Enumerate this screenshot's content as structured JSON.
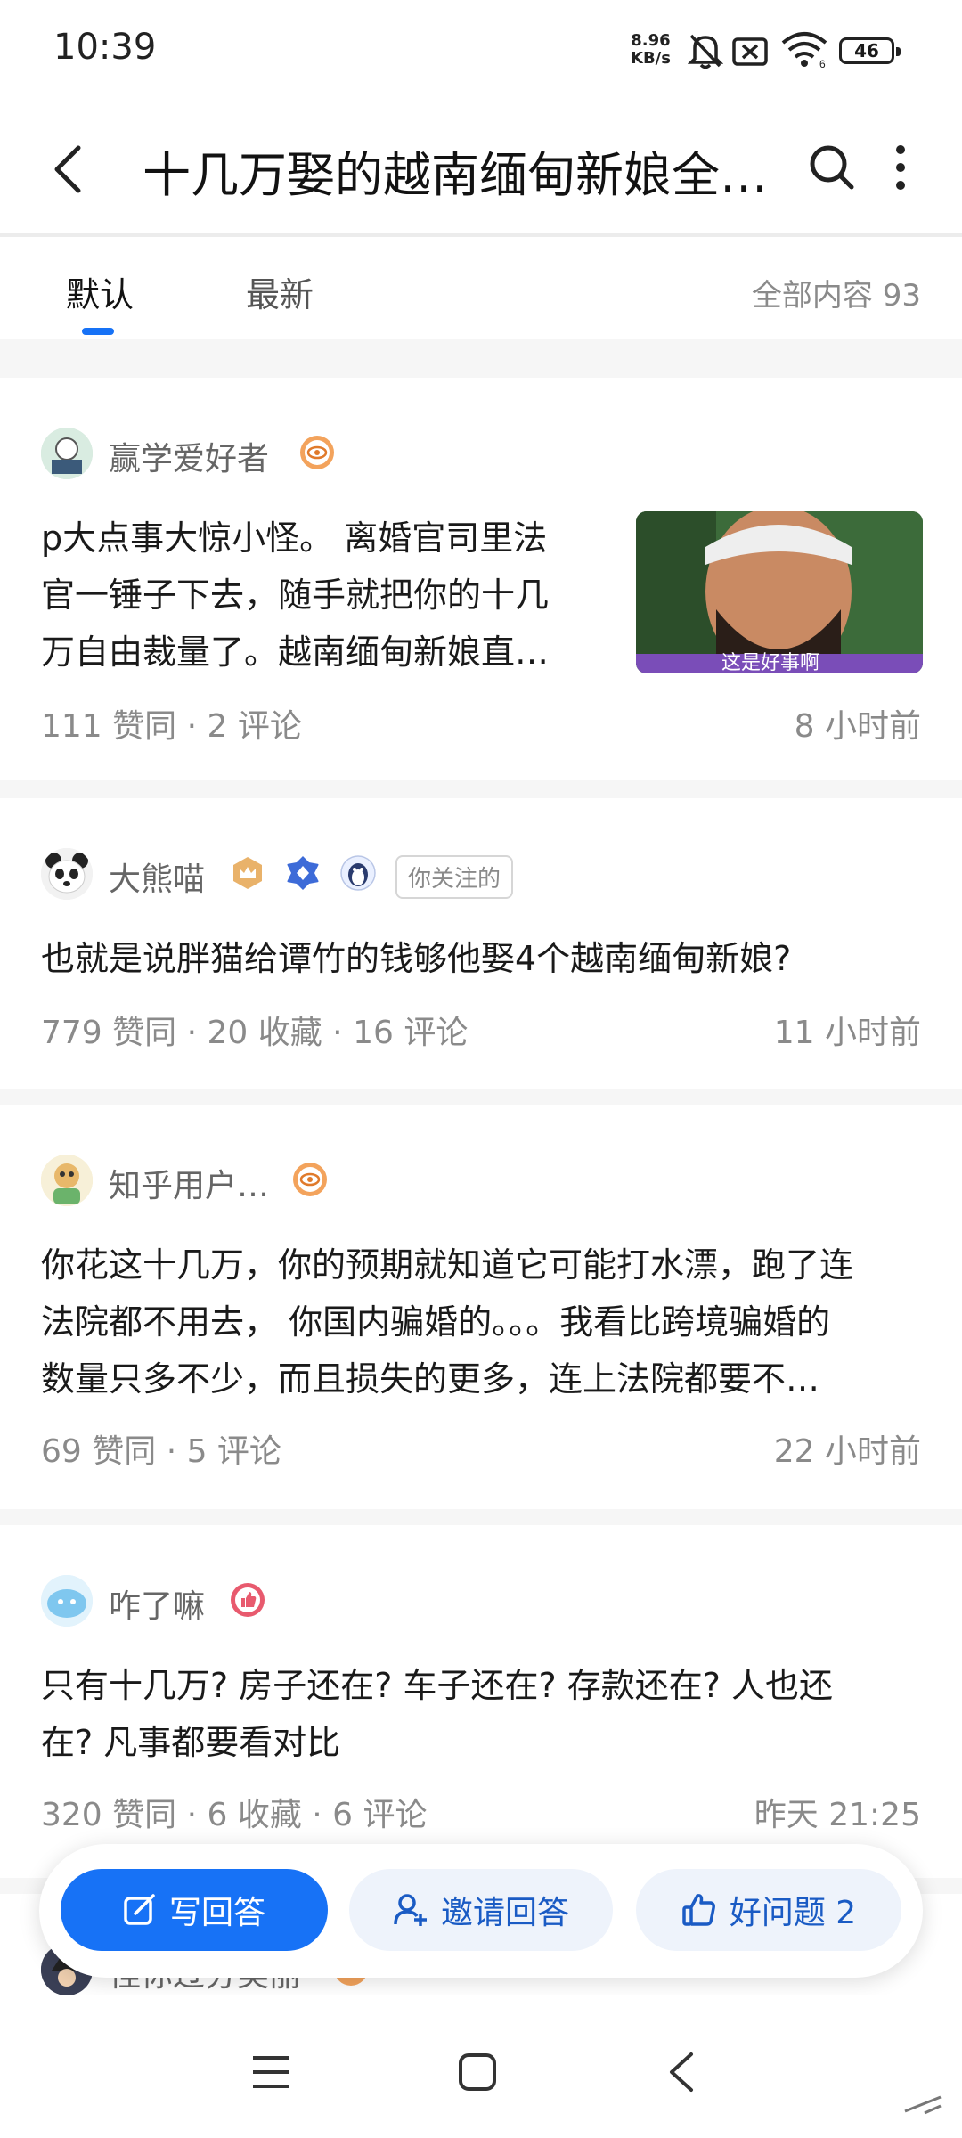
{
  "status_bar": {
    "time": "10:39",
    "net_speed_value": "8.96",
    "net_speed_unit": "KB/s",
    "battery": "46",
    "icons": [
      "bell-off-icon",
      "sim-off-icon",
      "wifi-icon",
      "battery-icon"
    ]
  },
  "header": {
    "title": "十几万娶的越南缅甸新娘全…"
  },
  "tabs": {
    "items": [
      {
        "label": "默认",
        "selected": true
      },
      {
        "label": "最新",
        "selected": false
      }
    ],
    "total": "全部内容 93",
    "accent": "#1772f6"
  },
  "answers": [
    {
      "author": "赢学爱好者",
      "text": [
        "p大点事大惊小怪。 离婚官司里法",
        "官一锤子下去，随手就把你的十几",
        "万自由裁量了。越南缅甸新娘直…"
      ],
      "thumbnail_caption": "这是好事啊",
      "meta": "111 赞同 · 2 评论",
      "time": "8 小时前"
    },
    {
      "author": "大熊喵",
      "follow_tag": "你关注的",
      "text": [
        "也就是说胖猫给谭竹的钱够他娶4个越南缅甸新娘?"
      ],
      "meta": "779 赞同 · 20 收藏 · 16 评论",
      "time": "11 小时前"
    },
    {
      "author": "知乎用户…",
      "text": [
        "你花这十几万，你的预期就知道它可能打水漂，跑了连",
        "法院都不用去， 你国内骗婚的。。。我看比跨境骗婚的",
        "数量只多不少，而且损失的更多，连上法院都要不…"
      ],
      "meta": "69 赞同 · 5 评论",
      "time": "22 小时前"
    },
    {
      "author": "咋了嘛",
      "text": [
        "只有十几万? 房子还在? 车子还在? 存款还在? 人也还",
        "在?  凡事都要看对比"
      ],
      "meta": "320 赞同 · 6 收藏 · 6 评论",
      "time": "昨天 21:25"
    },
    {
      "author": "怪你过分美丽"
    }
  ],
  "actions": {
    "write": "写回答",
    "invite": "邀请回答",
    "good_question": "好问题 2"
  }
}
